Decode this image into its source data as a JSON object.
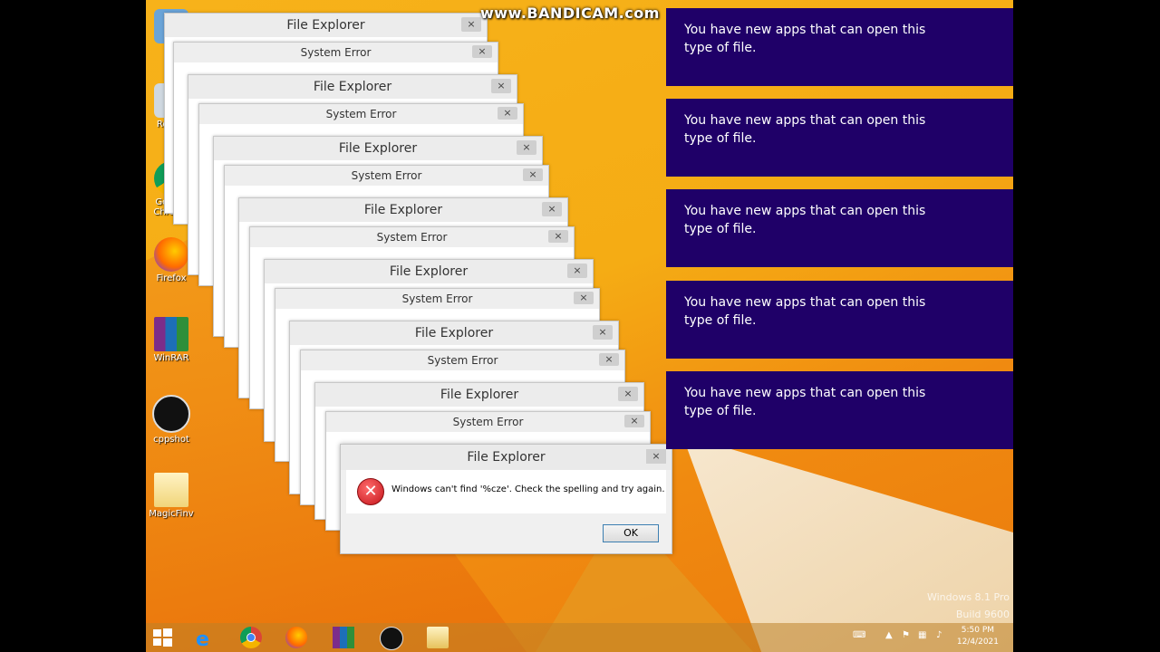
{
  "watermark": "www.BANDICAM.com",
  "desktop_icons": [
    "Recycl",
    "Google Chrome",
    "Firefox",
    "WinRAR",
    "cppshot",
    "MagicFinv"
  ],
  "dialogs": {
    "file_explorer_title": "File Explorer",
    "system_error_title": "System Error",
    "close_glyph": "×"
  },
  "main_dialog": {
    "title": "File Explorer",
    "message": "Windows can't find '%cze'. Check the spelling and try again.",
    "ok_label": "OK"
  },
  "toasts": [
    "You have new apps that can open this type of file.",
    "You have new apps that can open this type of file.",
    "You have new apps that can open this type of file.",
    "You have new apps that can open this type of file.",
    "You have new apps that can open this type of file."
  ],
  "os_watermark": {
    "line1": "Windows 8.1 Pro",
    "line2": "Build 9600"
  },
  "clock": {
    "time": "5:50 PM",
    "date": "12/4/2021"
  },
  "colors": {
    "toast_bg": "#1f0068",
    "desktop": "#f5ac14"
  }
}
